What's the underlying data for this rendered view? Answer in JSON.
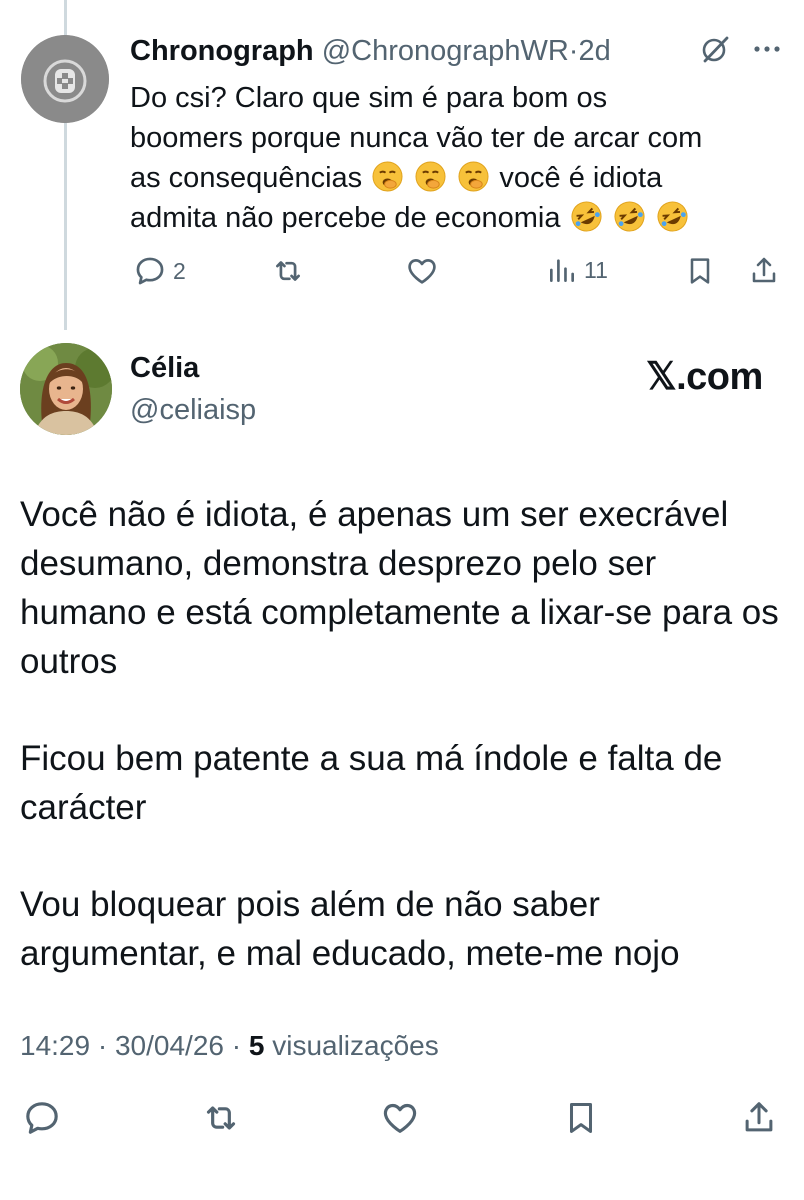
{
  "reply": {
    "name": "Chronograph",
    "handle": "@ChronographWR",
    "separator": "·",
    "time": "2d",
    "text_line1": "Do csi? Claro que sim é para bom os",
    "text_line2": "boomers porque nunca vão ter de arcar com",
    "text_line3a": "as consequências",
    "text_line3b": "você é idiota",
    "text_line4": "admita não percebe de economia",
    "emoji_1": "yawning-face",
    "emoji_2": "rolling-on-floor-laughing",
    "replies_count": "2",
    "views_count": "11"
  },
  "main": {
    "name": "Célia",
    "handle": "@celiaisp",
    "brand": "𝕏.com",
    "para1": "Você não é idiota, é apenas um ser execrável desumano, demonstra desprezo pelo ser humano e está completamente a lixar-se para os outros",
    "para2": "Ficou bem patente a sua má índole e falta de carácter",
    "para3": "Vou bloquear pois além de não saber argumentar, e mal educado, mete-me nojo",
    "time": "14:29",
    "dot": "·",
    "date": "30/04/26",
    "views_count": "5",
    "views_label": "visualizações"
  },
  "colors": {
    "text": "#0f1419",
    "muted": "#536471",
    "thread_line": "#cfd9de"
  }
}
